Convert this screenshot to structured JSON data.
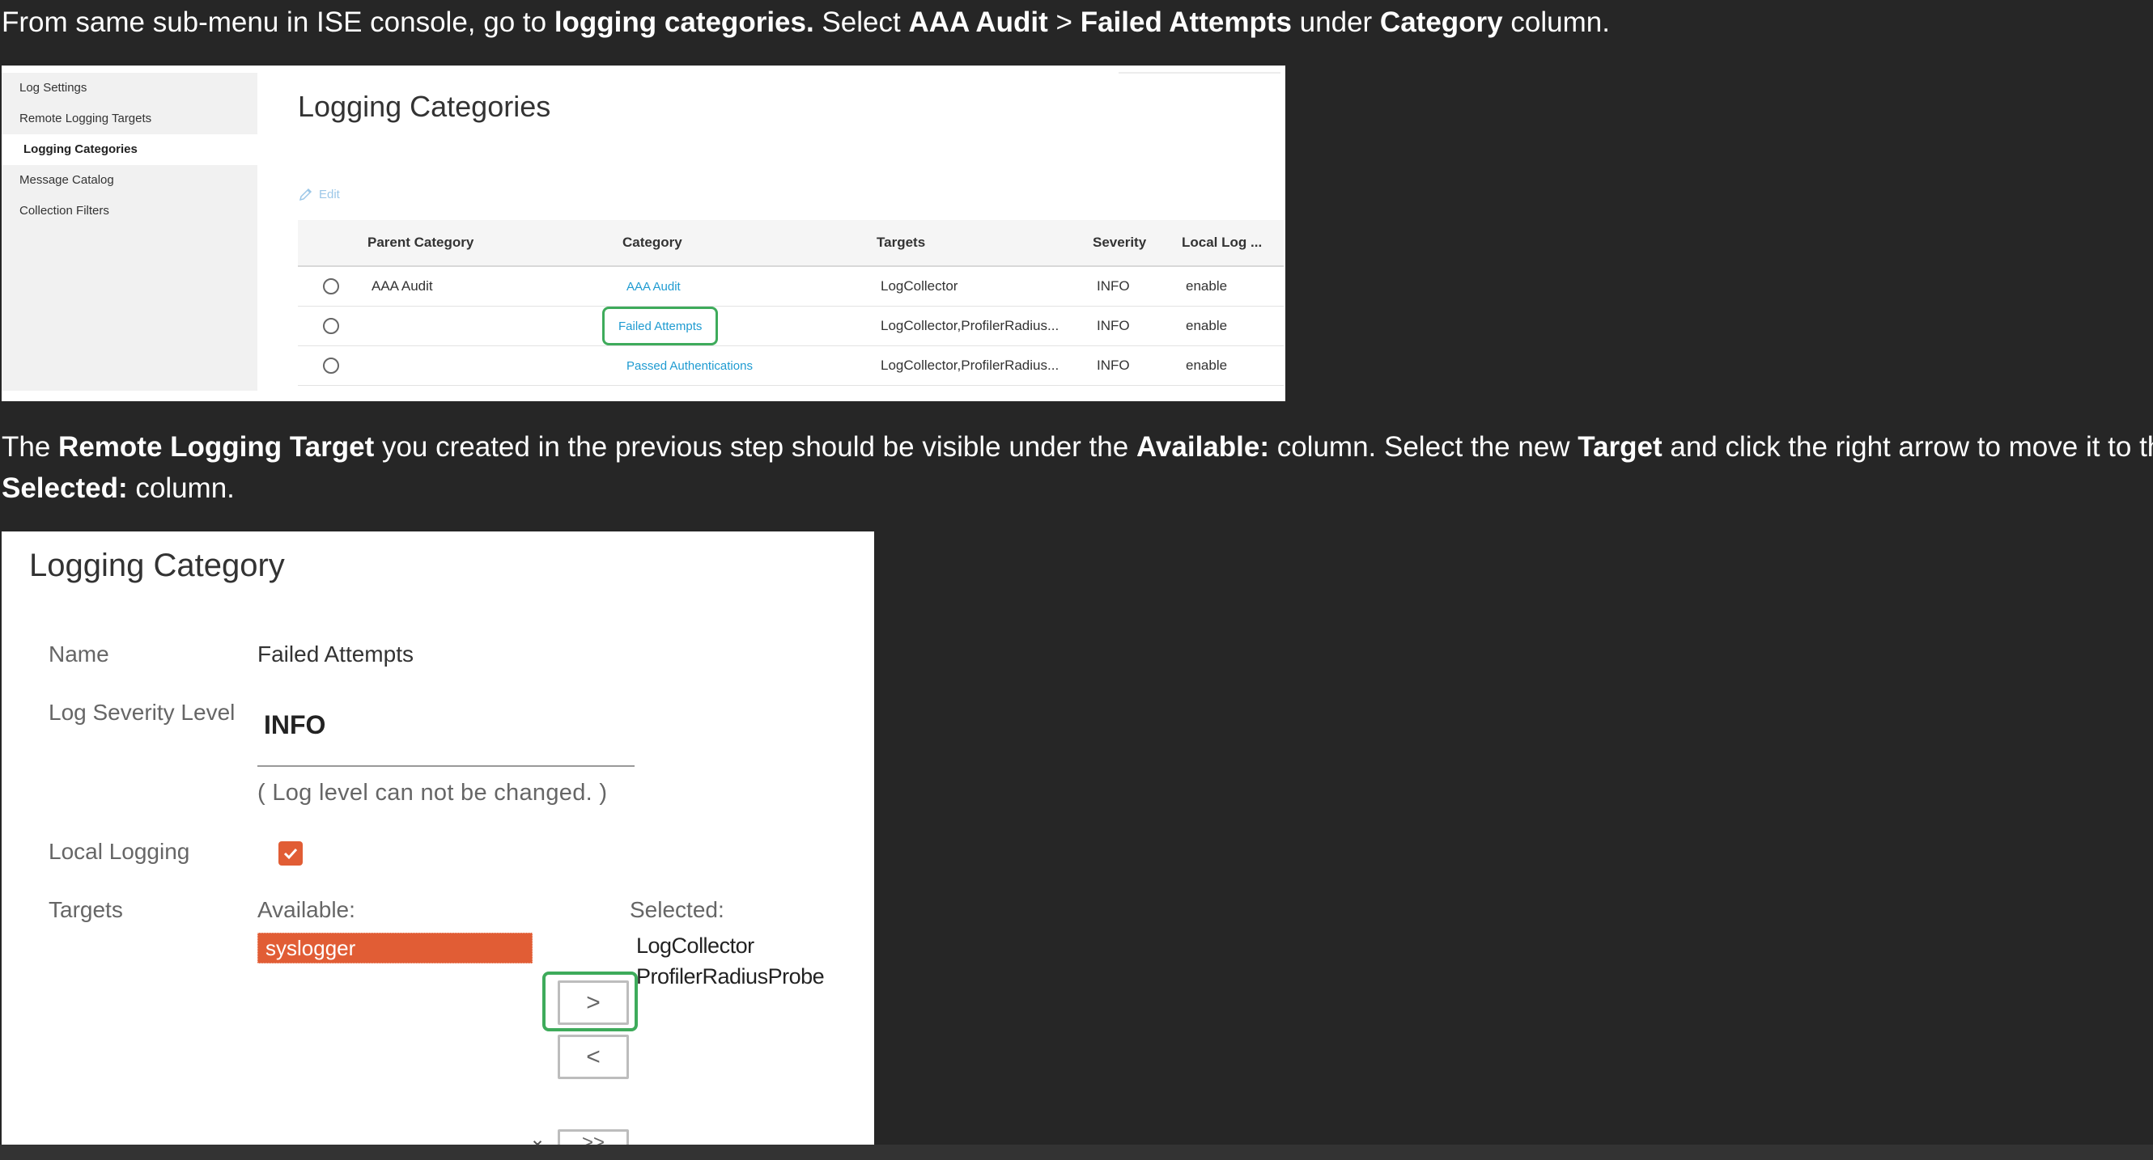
{
  "instructions": {
    "line1": [
      "From same sub-menu in ISE console, go to ",
      "logging categories.",
      "  Select ",
      "AAA Audit",
      " > ",
      "Failed Attempts",
      " under ",
      "Category",
      " column."
    ],
    "line2": [
      "The ",
      "Remote Logging Target",
      " you created in the previous step should be visible under the ",
      "Available:",
      " column.  Select the new ",
      "Target",
      " and click the right arrow to move it to the"
    ],
    "line3": [
      "Selected:",
      " column."
    ]
  },
  "screenshot1": {
    "sidebar": [
      "Log Settings",
      "Remote Logging Targets",
      "Logging Categories",
      "Message Catalog",
      "Collection Filters"
    ],
    "active_sidebar": "Logging Categories",
    "title": "Logging Categories",
    "edit_label": "Edit",
    "columns": [
      "",
      "Parent Category",
      "Category",
      "Targets",
      "Severity",
      "Local Log ..."
    ],
    "rows": [
      {
        "parent": "AAA Audit",
        "category": "AAA Audit",
        "targets": "LogCollector",
        "severity": "INFO",
        "local": "enable"
      },
      {
        "parent": "",
        "category": "Failed Attempts",
        "targets": "LogCollector,ProfilerRadius...",
        "severity": "INFO",
        "local": "enable"
      },
      {
        "parent": "",
        "category": "Passed Authentications",
        "targets": "LogCollector,ProfilerRadius...",
        "severity": "INFO",
        "local": "enable"
      }
    ],
    "highlighted_category": "Failed Attempts"
  },
  "screenshot2": {
    "title": "Logging Category",
    "name_label": "Name",
    "name_value": "Failed Attempts",
    "severity_label": "Log Severity Level",
    "severity_value": "INFO",
    "severity_note": "( Log level can not be changed. )",
    "local_logging_label": "Local Logging",
    "local_logging_checked": true,
    "targets_label": "Targets",
    "available_label": "Available:",
    "available_items": [
      "syslogger"
    ],
    "selected_label": "Selected:",
    "selected_items": [
      "LogCollector",
      "ProfilerRadiusProbe"
    ],
    "move_right": ">",
    "move_left": "<",
    "move_all_right": ">>",
    "chevron": "⌄"
  },
  "colors": {
    "background": "#262626",
    "highlight_green": "#3eab5b",
    "selection_orange": "#e15d35",
    "link_blue": "#1f9bd1"
  }
}
